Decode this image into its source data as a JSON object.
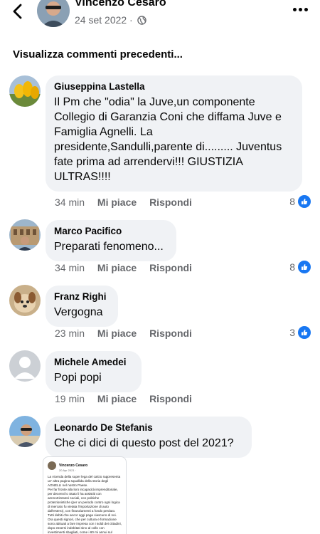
{
  "header": {
    "name": "Vincenzo Cesaro",
    "date": "24 set 2022 ·",
    "back_icon": "chevron-left-icon",
    "more_icon": "more-dots-icon",
    "globe_icon": "globe-icon"
  },
  "prev_comments_label": "Visualizza commenti precedenti...",
  "comments": [
    {
      "author": "Giuseppina Lastella",
      "text": "Il Pm che \"odia\" la Juve,un componente Collegio di Garanzia Coni che diffama Juve e Famiglia Agnelli. La presidente,Sandulli,parente di......... Juventus fate prima ad arrendervi!!! GIUSTIZIA ULTRAS!!!!",
      "time": "34 min",
      "like_label": "Mi piace",
      "reply_label": "Rispondi",
      "likes": "8"
    },
    {
      "author": "Marco Pacifico",
      "text": "Preparati fenomeno...",
      "time": "34 min",
      "like_label": "Mi piace",
      "reply_label": "Rispondi",
      "likes": "8"
    },
    {
      "author": "Franz Righi",
      "text": "Vergogna",
      "time": "23 min",
      "like_label": "Mi piace",
      "reply_label": "Rispondi",
      "likes": "3"
    },
    {
      "author": "Michele Amedei",
      "text": "Popi popi",
      "time": "19 min",
      "like_label": "Mi piace",
      "reply_label": "Rispondi"
    },
    {
      "author": "Leonardo De Stefanis",
      "text": "Che ci dici di questo post del 2021?"
    }
  ],
  "attachment": {
    "name": "Vincenzo Cesaro",
    "date": "20 Apr 2021 ·",
    "text": "La vicenda della super lega del calcio rappresenta un' altra pagina squallida della storia degli AGNELLI nel nostro Paese.\nPer far fronte alla loro incapacità imprenditoriale, per decenni lo Stato li ha assistiti con ammortizzatori sociali, con politiche protezionistiche (per un periodo contro ogni logica di mercato fu vietata l'importazione di auto dall'estero), con finanziamenti a fondo perduto.\nTutti debiti che ancor oggi paga ciascuno di noi.\nOra questi signori, che per cultura e formazione sono abituati a fare impresa con i soldi dei cittadini, dopo essersi indebitati sino al collo con investimenti sbagliati, come i 60 mi annui sul"
  },
  "colors": {
    "bubble": "#f0f2f5",
    "like_blue": "#1877f2",
    "secondary_text": "#65676b"
  }
}
